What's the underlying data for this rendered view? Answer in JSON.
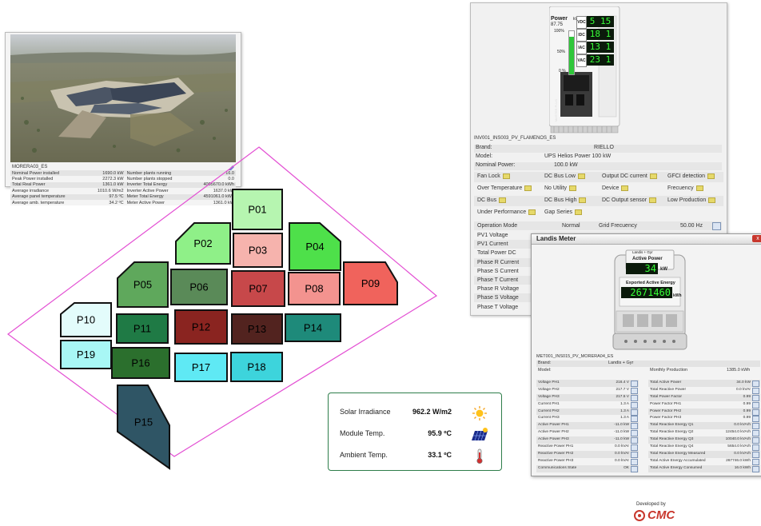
{
  "plant": {
    "name": "MORERA03_ES",
    "rows": [
      {
        "l1": "Nominal Power installed",
        "v1": "1690.0 kW",
        "l2": "Number plants running",
        "v2": "16.0"
      },
      {
        "l1": "Peak Power installed",
        "v1": "2272.3 kW",
        "l2": "Number plants stopped",
        "v2": "0.0"
      },
      {
        "l1": "Total Real Power",
        "v1": "1361.0 kW",
        "l2": "Inverter Total Energy",
        "v2": "4005670.0 kWh"
      },
      {
        "l1": "Average irradiance",
        "v1": "1010.6 W/m2",
        "l2": "Inverter Active Power",
        "v2": "1637.0 kW"
      },
      {
        "l1": "Average panel temperature",
        "v1": "97.5 ºC",
        "l2": "Meter Total Energy",
        "v2": "4591061.0 kWh"
      },
      {
        "l1": "Average amb. temperature",
        "v1": "34.2 ºC",
        "l2": "Meter Active Power",
        "v2": "1361.0 kW"
      }
    ]
  },
  "plots": [
    {
      "id": "P01",
      "label": "P01",
      "color": "#b6f5b0"
    },
    {
      "id": "P02",
      "label": "P02",
      "color": "#8ff088"
    },
    {
      "id": "P03",
      "label": "P03",
      "color": "#f6b3ad"
    },
    {
      "id": "P04",
      "label": "P04",
      "color": "#4ee04a"
    },
    {
      "id": "P05",
      "label": "P05",
      "color": "#5fa85c"
    },
    {
      "id": "P06",
      "label": "P06",
      "color": "#5a8a58"
    },
    {
      "id": "P07",
      "label": "P07",
      "color": "#c7484a"
    },
    {
      "id": "P08",
      "label": "P08",
      "color": "#f3938f"
    },
    {
      "id": "P09",
      "label": "P09",
      "color": "#f0635c"
    },
    {
      "id": "P10",
      "label": "P10",
      "color": "#e3fcfb"
    },
    {
      "id": "P11",
      "label": "P11",
      "color": "#1f7a45"
    },
    {
      "id": "P12",
      "label": "P12",
      "color": "#8a2420"
    },
    {
      "id": "P13",
      "label": "P13",
      "color": "#52231f"
    },
    {
      "id": "P14",
      "label": "P14",
      "color": "#1e8a7a"
    },
    {
      "id": "P15",
      "label": "P15",
      "color": "#2f5565"
    },
    {
      "id": "P16",
      "label": "P16",
      "color": "#2b6f2d"
    },
    {
      "id": "P17",
      "label": "P17",
      "color": "#5fe9f4"
    },
    {
      "id": "P18",
      "label": "P18",
      "color": "#3dd4dc"
    },
    {
      "id": "P19",
      "label": "P19",
      "color": "#a8f7f5"
    }
  ],
  "environment": {
    "irradiance_label": "Solar Irradiance",
    "irradiance_value": "962.2 W/m2",
    "module_label": "Module Temp.",
    "module_value": "95.9 ºC",
    "ambient_label": "Ambient Temp.",
    "ambient_value": "33.1 ºC"
  },
  "inverter": {
    "gauge_title": "Power",
    "gauge_pct": "87.75",
    "gauge_unit": "%",
    "gauge_100": "100%",
    "gauge_50": "50%",
    "gauge_0": "0 %",
    "gauge_fill": 0.8775,
    "gauge_extra": "kW",
    "lcd": [
      {
        "tag": "VDC",
        "value": "5 15"
      },
      {
        "tag": "IDC",
        "value": "18 1"
      },
      {
        "tag": "IAC",
        "value": "13 1"
      },
      {
        "tag": "VAC",
        "value": "23 1"
      }
    ],
    "model_tag": "MASTER PLUS",
    "name": "INV001_INS003_PV_FLAMENOS_ES",
    "brand_label": "Brand:",
    "brand_value": "RIELLO",
    "model_label": "Model:",
    "model_value": "UPS Helios Power 100 kW",
    "nominal_label": "Nominal Power:",
    "nominal_value": "100.0 kW",
    "alarms": [
      [
        "Fan Lock",
        "DC Bus Low",
        "Output DC current",
        "GFCI detection"
      ],
      [
        "Over Temperature",
        "No Utility",
        "Device",
        "Frecuency"
      ],
      [
        "DC Bus",
        "DC Bus High",
        "DC Output sensor",
        "Low Production"
      ],
      [
        "Under Performance",
        "Gap Series"
      ]
    ],
    "operation_label": "Operation Mode",
    "operation_value": "Normal",
    "grid_label": "Grid Frecuency",
    "grid_value": "50.00 Hz",
    "measures": [
      "PV1 Voltage",
      "PV1 Current",
      "Total Power DC",
      "Phase R Current",
      "Phase S Current",
      "Phase T Current",
      "Phase R Voltage",
      "Phase S Voltage",
      "Phase T Voltage"
    ]
  },
  "meter": {
    "title": "Landis Meter",
    "close": "x",
    "device_brand": "Landis + Gyr",
    "active_power_label": "Active Power",
    "active_power_value": "34",
    "active_power_unit": "kW",
    "exported_label": "Exported Active Energy",
    "exported_value": "2671460",
    "exported_unit": "kWh",
    "name": "MET001_INS015_PV_MORERA04_ES",
    "brand_label": "Brand:",
    "brand_value": "Landis + Gyr",
    "model_label": "Model:",
    "monthly_label": "Monthly Production",
    "monthly_value": "1385.0 kWh",
    "left_rows": [
      {
        "l": "Voltage PH1",
        "v": "216.4 V"
      },
      {
        "l": "Voltage PH2",
        "v": "217.7 V"
      },
      {
        "l": "Voltage PH3",
        "v": "217.5 V"
      },
      {
        "l": "Current PH1",
        "v": "1.3 A"
      },
      {
        "l": "Current PH2",
        "v": "1.3 A"
      },
      {
        "l": "Current PH3",
        "v": "1.3 A"
      },
      {
        "l": "Active Power PH1",
        "v": "-11.0 kW"
      },
      {
        "l": "Active Power PH2",
        "v": "-11.0 kW"
      },
      {
        "l": "Active Power PH3",
        "v": "-11.0 kW"
      },
      {
        "l": "Reactive Power PH1",
        "v": "0.0 kVAr"
      },
      {
        "l": "Reactive Power PH2",
        "v": "0.0 kVAr"
      },
      {
        "l": "Reactive Power PH3",
        "v": "0.0 kVAr"
      },
      {
        "l": "Communications State",
        "v": "OK"
      }
    ],
    "right_rows": [
      {
        "l": "Total Active Power",
        "v": "34.0 kW"
      },
      {
        "l": "Total Reactive Power",
        "v": "0.0 kVAr"
      },
      {
        "l": "Total Power Factor",
        "v": "0.99"
      },
      {
        "l": "Power Factor PH1",
        "v": "0.99"
      },
      {
        "l": "Power Factor PH2",
        "v": "0.99"
      },
      {
        "l": "Power Factor PH3",
        "v": "0.99"
      },
      {
        "l": "Total Reactive Energy Q1",
        "v": "0.0 kVArh"
      },
      {
        "l": "Total Reactive Energy Q2",
        "v": "12454.0 kVArh"
      },
      {
        "l": "Total Reactive Energy Q3",
        "v": "10040.0 kVArh"
      },
      {
        "l": "Total Reactive Energy Q4",
        "v": "5654.0 kVArh"
      },
      {
        "l": "Total Reactive Energy Measured",
        "v": "0.0 kVArh"
      },
      {
        "l": "Total Active Energy Accumulated",
        "v": "267746.0 kWh"
      },
      {
        "l": "Total Active Energy Consumed",
        "v": "16.0 kWh"
      }
    ]
  },
  "footer": {
    "developed_by": "Developed by",
    "logo_text": "CMC"
  },
  "colors": {
    "boundary": "#e34fd3",
    "env_border": "#2e7d4a",
    "lcd_bg": "#0b1a0b",
    "lcd_fg": "#38ff38"
  }
}
